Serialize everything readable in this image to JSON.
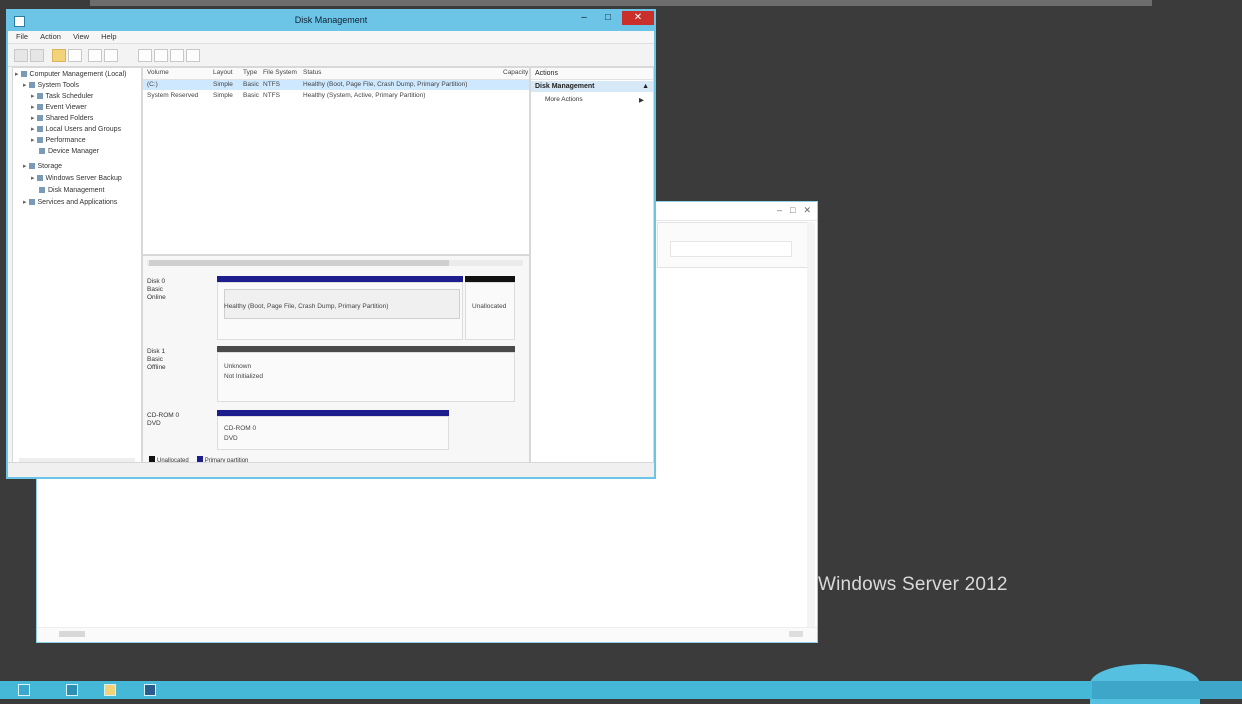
{
  "desktop": {
    "watermark": "Windows Server 2012"
  },
  "main_window": {
    "title": "Disk Management",
    "controls": {
      "minimize": "–",
      "maximize": "□",
      "close": "✕"
    },
    "menu": [
      "File",
      "Action",
      "View",
      "Help"
    ],
    "tree": {
      "items": [
        "Computer Management (Local)",
        "System Tools",
        "Task Scheduler",
        "Event Viewer",
        "Shared Folders",
        "Local Users and Groups",
        "Performance",
        "Device Manager",
        "Storage",
        "Windows Server Backup",
        "Disk Management",
        "Services and Applications"
      ]
    },
    "list": {
      "columns": [
        "Volume",
        "Layout",
        "Type",
        "File System",
        "Status",
        "Capacity"
      ],
      "rows": [
        {
          "volume": "(C:)",
          "layout": "Simple",
          "type": "Basic",
          "fs": "NTFS",
          "status": "Healthy (Boot, Page File, Crash Dump, Primary Partition)",
          "capacity": ""
        },
        {
          "volume": "System Reserved",
          "layout": "Simple",
          "type": "Basic",
          "fs": "NTFS",
          "status": "Healthy (System, Active, Primary Partition)",
          "capacity": ""
        }
      ]
    },
    "disks": [
      {
        "name": "Disk 0",
        "type": "Basic",
        "size": "",
        "state": "Online"
      },
      {
        "name": "Disk 1",
        "type": "Basic",
        "size": "",
        "state": "Offline"
      },
      {
        "name": "CD-ROM 0",
        "type": "DVD",
        "size": "",
        "state": ""
      }
    ],
    "volumes": {
      "disk0_main": "Healthy (Boot, Page File, Crash Dump, Primary Partition)",
      "disk0_side": "Unallocated",
      "disk1_label": "Unknown",
      "disk1_text": "Not Initialized",
      "cd_label": "CD-ROM 0",
      "cd_text": "DVD"
    },
    "legend": [
      "Unallocated",
      "Primary partition"
    ],
    "actions": {
      "header": "Actions",
      "section": "Disk Management",
      "more": "More Actions",
      "arrow": "▲",
      "more_arrow": "▶"
    }
  },
  "taskbar": {
    "time": ""
  },
  "colors": {
    "titlebar": "#6cc4e6",
    "taskbar": "#45b8d8",
    "primary_partition": "#1d1d8e",
    "selection": "#cde8ff"
  }
}
